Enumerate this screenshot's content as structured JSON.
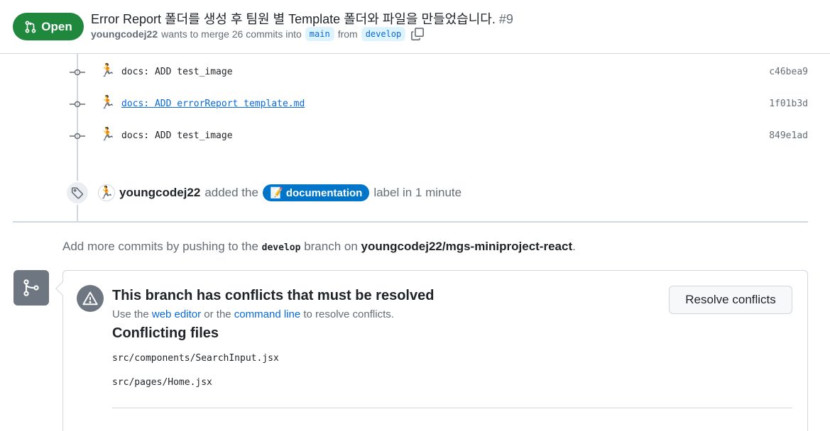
{
  "header": {
    "state_label": "Open",
    "title": "Error Report 폴더를 생성 후 팀원 별 Template 폴더와 파일을 만들었습니다.",
    "number": "#9",
    "author": "youngcodej22",
    "merge_text": "wants to merge 26 commits into",
    "base_branch": "main",
    "from_text": "from",
    "head_branch": "develop"
  },
  "commits": [
    {
      "avatar": "🏃",
      "message": "docs: ADD test_image",
      "sha": "c46bea9",
      "linked": false
    },
    {
      "avatar": "🏃",
      "message": "docs: ADD errorReport template.md",
      "sha": "1f01b3d",
      "linked": true
    },
    {
      "avatar": "🏃",
      "message": "docs: ADD test_image",
      "sha": "849e1ad",
      "linked": false
    }
  ],
  "label_event": {
    "avatar": "🏃",
    "author": "youngcodej22",
    "action": "added the",
    "label_emoji": "📝",
    "label_name": "documentation",
    "label_color": "#0075ca",
    "suffix": "label in 1 minute"
  },
  "hint": {
    "prefix": "Add more commits by pushing to the",
    "branch": "develop",
    "middle": "branch on",
    "repo": "youngcodej22/mgs-miniproject-react",
    "end": "."
  },
  "merge_box": {
    "title": "This branch has conflicts that must be resolved",
    "sub_prefix": "Use the",
    "web_editor": "web editor",
    "sub_middle": "or the",
    "command_line": "command line",
    "sub_suffix": "to resolve conflicts.",
    "resolve_button": "Resolve conflicts",
    "files_heading": "Conflicting files",
    "files": [
      "src/components/SearchInput.jsx",
      "src/pages/Home.jsx"
    ]
  },
  "colors": {
    "open_green": "#1f883d",
    "link_blue": "#0969da",
    "label_blue": "#0075ca",
    "muted_gray": "#656d76"
  }
}
